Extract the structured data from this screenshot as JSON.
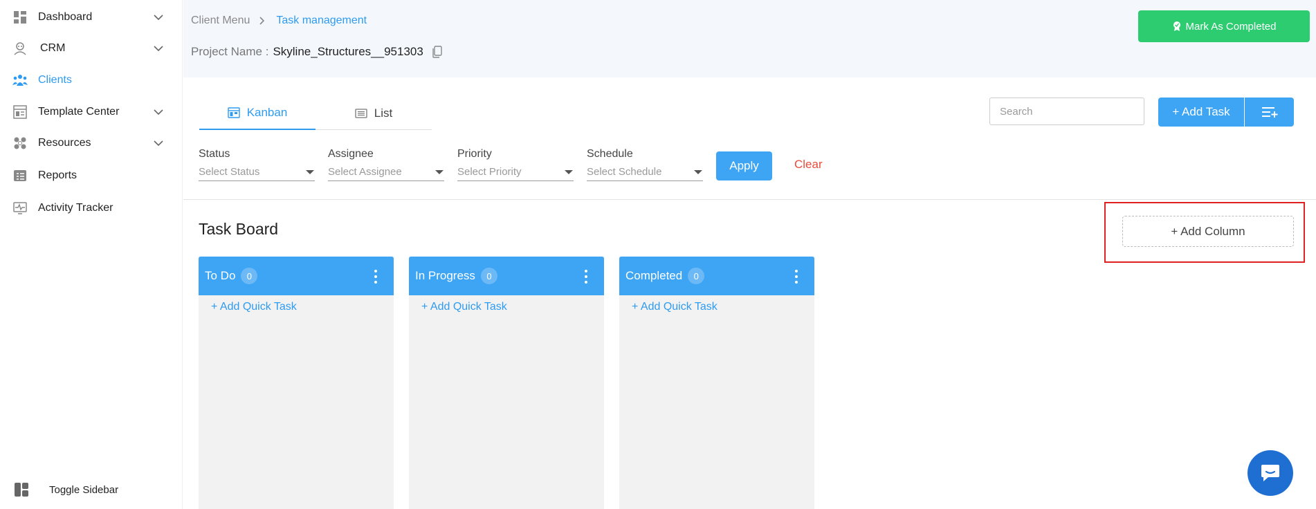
{
  "sidebar": {
    "items": [
      {
        "label": "Dashboard",
        "icon": "dashboard-icon",
        "has_chevron": true
      },
      {
        "label": "CRM",
        "icon": "crm-icon",
        "has_chevron": true
      },
      {
        "label": "Clients",
        "icon": "clients-icon",
        "active": true
      },
      {
        "label": "Template Center",
        "icon": "template-icon",
        "has_chevron": true
      },
      {
        "label": "Resources",
        "icon": "resources-icon",
        "has_chevron": true
      },
      {
        "label": "Reports",
        "icon": "reports-icon"
      },
      {
        "label": "Activity Tracker",
        "icon": "activity-icon"
      }
    ],
    "toggle_label": "Toggle Sidebar"
  },
  "header": {
    "breadcrumb_root": "Client Menu",
    "breadcrumb_current": "Task management",
    "project_label": "Project Name :",
    "project_value": "Skyline_Structures__951303",
    "mark_completed_label": "Mark As Completed"
  },
  "tabs": [
    {
      "label": "Kanban",
      "active": true
    },
    {
      "label": "List",
      "active": false
    }
  ],
  "toolbar": {
    "search_placeholder": "Search",
    "add_task_label": "+ Add Task"
  },
  "filters": [
    {
      "label": "Status",
      "placeholder": "Select Status"
    },
    {
      "label": "Assignee",
      "placeholder": "Select Assignee"
    },
    {
      "label": "Priority",
      "placeholder": "Select Priority"
    },
    {
      "label": "Schedule",
      "placeholder": "Select Schedule"
    }
  ],
  "apply_label": "Apply",
  "clear_label": "Clear",
  "board": {
    "title": "Task Board",
    "add_column_label": "+ Add Column",
    "columns": [
      {
        "title": "To Do",
        "count": "0",
        "quick_add": "+ Add Quick Task"
      },
      {
        "title": "In Progress",
        "count": "0",
        "quick_add": "+ Add Quick Task"
      },
      {
        "title": "Completed",
        "count": "0",
        "quick_add": "+ Add Quick Task"
      }
    ]
  },
  "colors": {
    "accent": "#3da5f4",
    "success": "#2ecc71",
    "danger": "#e94b3c",
    "highlight": "#e02020"
  }
}
